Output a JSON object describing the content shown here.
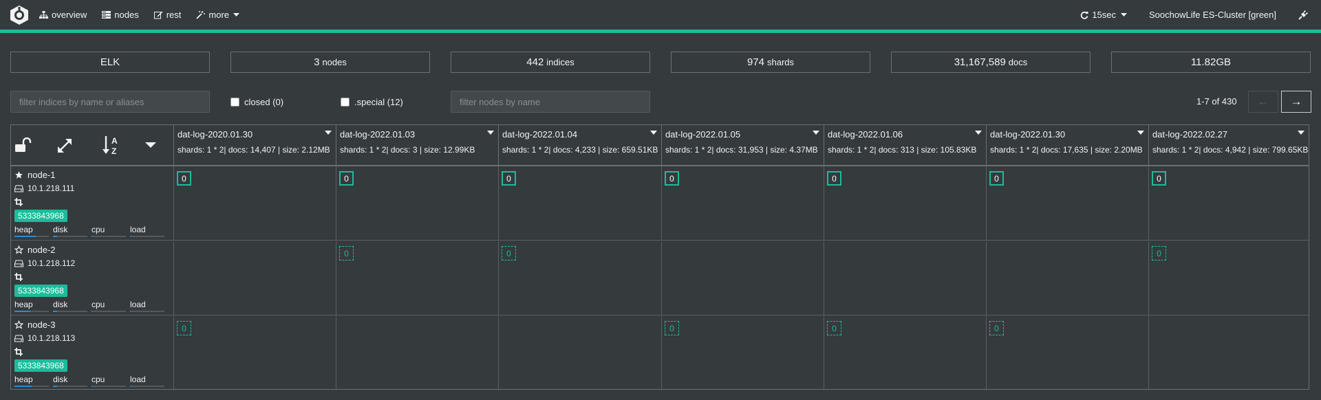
{
  "nav": {
    "overview": "overview",
    "nodes": "nodes",
    "rest": "rest",
    "more": "more",
    "refresh": "15sec",
    "cluster": "SoochowLife ES-Cluster [green]"
  },
  "stats": [
    {
      "value": "ELK",
      "unit": ""
    },
    {
      "value": "3",
      "unit": "nodes"
    },
    {
      "value": "442",
      "unit": "indices"
    },
    {
      "value": "974",
      "unit": "shards"
    },
    {
      "value": "31,167,589",
      "unit": "docs"
    },
    {
      "value": "11.82GB",
      "unit": ""
    }
  ],
  "filters": {
    "indices_placeholder": "filter indices by name or aliases",
    "closed": "closed (0)",
    "special": ".special (12)",
    "nodes_placeholder": "filter nodes by name"
  },
  "pager": {
    "text": "1-7 of 430",
    "prev": "←",
    "next": "→"
  },
  "indices": [
    {
      "name": "dat-log-2020.01.30",
      "meta": "shards: 1 * 2| docs: 14,407 | size: 2.12MB"
    },
    {
      "name": "dat-log-2022.01.03",
      "meta": "shards: 1 * 2| docs: 3 | size: 12.99KB"
    },
    {
      "name": "dat-log-2022.01.04",
      "meta": "shards: 1 * 2| docs: 4,233 | size: 659.51KB"
    },
    {
      "name": "dat-log-2022.01.05",
      "meta": "shards: 1 * 2| docs: 31,953 | size: 4.37MB"
    },
    {
      "name": "dat-log-2022.01.06",
      "meta": "shards: 1 * 2| docs: 313 | size: 105.83KB"
    },
    {
      "name": "dat-log-2022.01.30",
      "meta": "shards: 1 * 2| docs: 17,635 | size: 2.20MB"
    },
    {
      "name": "dat-log-2022.02.27",
      "meta": "shards: 1 * 2| docs: 4,942 | size: 799.65KB"
    }
  ],
  "nodes": [
    {
      "name": "node-1",
      "ip": "10.1.218.111",
      "badge": "5333843968",
      "master": true,
      "metrics": [
        {
          "label": "heap",
          "fill": 0.62
        },
        {
          "label": "disk",
          "fill": 0.12
        },
        {
          "label": "cpu",
          "fill": 0.02
        },
        {
          "label": "load",
          "fill": 0.02
        }
      ],
      "shards": [
        {
          "value": "0",
          "kind": "primary"
        },
        {
          "value": "0",
          "kind": "primary"
        },
        {
          "value": "0",
          "kind": "primary"
        },
        {
          "value": "0",
          "kind": "primary"
        },
        {
          "value": "0",
          "kind": "primary"
        },
        {
          "value": "0",
          "kind": "primary"
        },
        {
          "value": "0",
          "kind": "primary"
        }
      ]
    },
    {
      "name": "node-2",
      "ip": "10.1.218.112",
      "badge": "5333843968",
      "master": false,
      "metrics": [
        {
          "label": "heap",
          "fill": 0.45
        },
        {
          "label": "disk",
          "fill": 0.12
        },
        {
          "label": "cpu",
          "fill": 0.02
        },
        {
          "label": "load",
          "fill": 0.02
        }
      ],
      "shards": [
        null,
        {
          "value": "0",
          "kind": "replica"
        },
        {
          "value": "0",
          "kind": "replica"
        },
        null,
        null,
        null,
        {
          "value": "0",
          "kind": "replica"
        }
      ]
    },
    {
      "name": "node-3",
      "ip": "10.1.218.113",
      "badge": "5333843968",
      "master": false,
      "metrics": [
        {
          "label": "heap",
          "fill": 0.5
        },
        {
          "label": "disk",
          "fill": 0.12
        },
        {
          "label": "cpu",
          "fill": 0.02
        },
        {
          "label": "load",
          "fill": 0.02
        }
      ],
      "shards": [
        {
          "value": "0",
          "kind": "replica"
        },
        null,
        null,
        {
          "value": "0",
          "kind": "replica"
        },
        {
          "value": "0",
          "kind": "replica"
        },
        {
          "value": "0",
          "kind": "replica"
        },
        null
      ]
    }
  ],
  "colors": {
    "accent": "#1bbc9b",
    "background": "#353a3d",
    "metric_bar": "#2e8ccf"
  }
}
